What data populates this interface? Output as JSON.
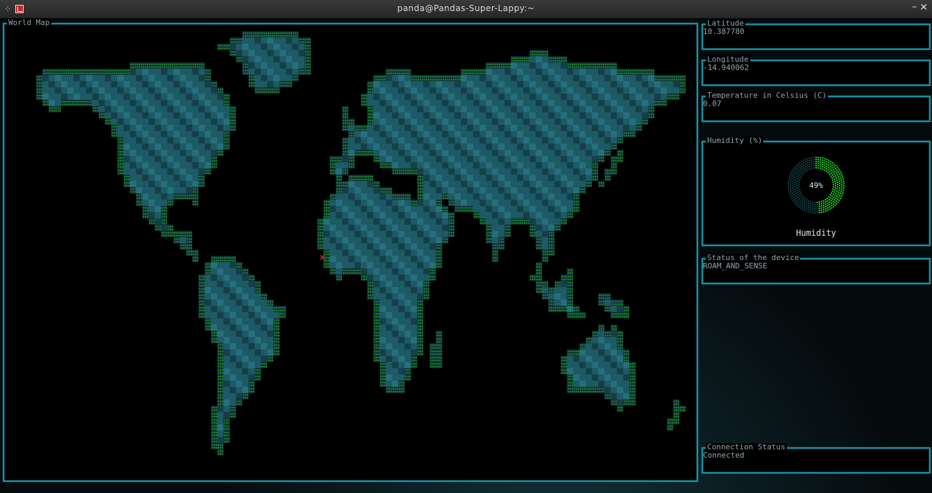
{
  "window": {
    "title": "panda@Pandas-Super-Lappy:~",
    "controls": {
      "minimize": "–",
      "close": "✕"
    }
  },
  "icons": {
    "grip": "grip-icon",
    "app": "terminal-app-icon",
    "marker": "device-location-marker"
  },
  "colors": {
    "panel_border": "#1e8fa0",
    "label_text": "#8fa5aa",
    "map_dot": "#27d827",
    "land_block": "#1d5a66",
    "marker": "#d03030"
  },
  "map": {
    "label": "World Map",
    "marker_position": {
      "latitude": 10.38778,
      "longitude": -14.940062
    }
  },
  "sidebar": {
    "latitude": {
      "label": "Latitude",
      "value": "10.387780"
    },
    "longitude": {
      "label": "Longitude",
      "value": "-14.940062"
    },
    "temperature": {
      "label": "Temperature in Celsius (C)",
      "value": "0.07"
    },
    "humidity": {
      "label": "Humidity (%)",
      "gauge_value": 49,
      "gauge_text": "49%",
      "caption": "Humidity"
    },
    "status": {
      "label": "Status of the device",
      "value": "ROAM_AND_SENSE"
    },
    "connection": {
      "label": "Connection Status",
      "value": "Connected"
    }
  }
}
